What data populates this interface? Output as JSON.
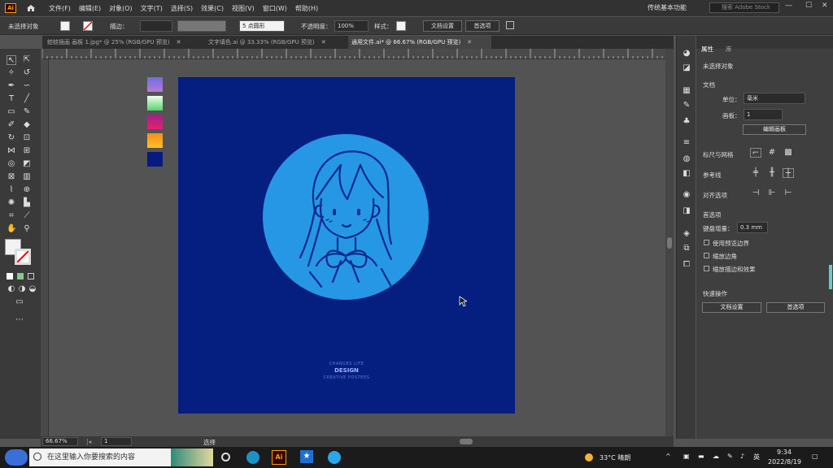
{
  "app": {
    "logo": "Ai"
  },
  "menu": [
    "文件(F)",
    "编辑(E)",
    "对象(O)",
    "文字(T)",
    "选择(S)",
    "效果(C)",
    "视图(V)",
    "窗口(W)",
    "帮助(H)"
  ],
  "workspace": "传统基本功能",
  "stock_search_placeholder": "搜索 Adobe Stock",
  "window_controls": {
    "min": "—",
    "max": "☐",
    "close": "✕"
  },
  "control_bar": {
    "selection": "未选择对象",
    "stroke_label": "描边：",
    "brush": "5 点圆形",
    "opacity_label": "不透明度：",
    "opacity_value": "100%",
    "style_label": "样式：",
    "doc_setup": "文档设置",
    "prefs": "首选项"
  },
  "tabs": [
    {
      "label": "蛙蛙插画 画板 1.jpg* @ 25% (RGB/GPU 预览)",
      "close": "✕"
    },
    {
      "label": "文字填色.ai @ 33.33% (RGB/GPU 预览)",
      "close": "✕"
    },
    {
      "label": "通用文件.ai* @ 66.67% (RGB/GPU 预览)",
      "close": "✕"
    }
  ],
  "artboard": {
    "line1": "CHANGES LIFE",
    "line2": "DESIGN",
    "line3": "CREATIVE POSTERS"
  },
  "colors": {
    "artboard_bg": "#041f7f",
    "circle": "#2697e4",
    "line_art": "#0b2a8c",
    "chips": [
      "#7e6bd1",
      "#8ee28c",
      "#c8248b",
      "#f59f1f",
      "#071a80"
    ]
  },
  "properties": {
    "tab_properties": "属性",
    "tab_layers": "库",
    "no_selection": "未选择对象",
    "document": "文档",
    "units_label": "单位：",
    "units_value": "毫米",
    "artboard_label": "画板：",
    "artboard_value": "1",
    "edit_artboards": "编辑画板",
    "rulers_grids": "标尺与网格",
    "guides": "参考线",
    "snap_options": "对齐选项",
    "preferences": "首选项",
    "keyboard_increment_label": "键盘增量：",
    "keyboard_increment_value": "0.3 mm",
    "check_preview_bounds": "使用预览边界",
    "check_scale_corners": "缩放边角",
    "check_scale_strokes": "缩放描边和效果",
    "quick_actions": "快速操作",
    "qa_doc_setup": "文档设置",
    "qa_prefs": "首选项"
  },
  "status_bar": {
    "zoom": "66.67%",
    "artboard_num": "1",
    "tool_name": "选择"
  },
  "taskbar": {
    "search_placeholder": "在这里输入你要搜索的内容",
    "weather": "33°C 晴朗",
    "lang": "英",
    "time": "9:34",
    "date": "2022/8/19"
  }
}
